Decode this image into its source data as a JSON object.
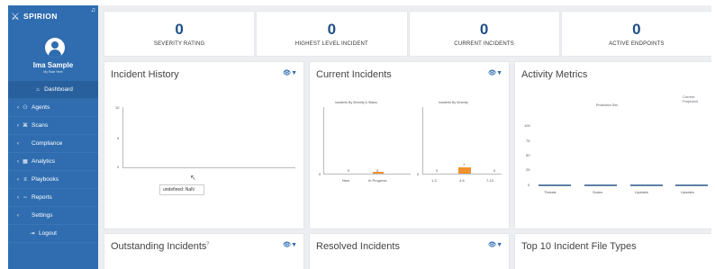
{
  "sidebar": {
    "brand": "SPIRION",
    "user_name": "Ima Sample",
    "user_role": "My Role Here",
    "items": [
      {
        "label": "Dashboard",
        "icon": "home-icon",
        "glyph": "⌂"
      },
      {
        "label": "Agents",
        "icon": "agents-icon",
        "glyph": "⚇"
      },
      {
        "label": "Scans",
        "icon": "scans-icon",
        "glyph": "⌘"
      },
      {
        "label": "Compliance",
        "icon": "compliance-icon",
        "glyph": ""
      },
      {
        "label": "Analytics",
        "icon": "analytics-icon",
        "glyph": "▦"
      },
      {
        "label": "Playbooks",
        "icon": "playbooks-icon",
        "glyph": "≡"
      },
      {
        "label": "Reports",
        "icon": "reports-icon",
        "glyph": "∼"
      },
      {
        "label": "Settings",
        "icon": "settings-icon",
        "glyph": ""
      },
      {
        "label": "Logout",
        "icon": "logout-icon",
        "glyph": "⇥"
      }
    ]
  },
  "stats": [
    {
      "value": "0",
      "label": "SEVERITY RATING"
    },
    {
      "value": "0",
      "label": "HIGHEST LEVEL INCIDENT"
    },
    {
      "value": "0",
      "label": "CURRENT INCIDENTS"
    },
    {
      "value": "0",
      "label": "ACTIVE ENDPOINTS"
    }
  ],
  "cards": {
    "incident_history": {
      "title": "Incident History",
      "tooltip": "undefined: NaN",
      "y_ticks": [
        "10",
        "5",
        "0"
      ]
    },
    "current_incidents": {
      "title": "Current Incidents",
      "left_title": "Incidents By Severity & Status",
      "right_title": "Incidents By Severity",
      "left_x": [
        "New",
        "In Progress"
      ],
      "left_values": [
        "0",
        "0"
      ],
      "right_x": [
        "1-3",
        "4-6",
        "7-10"
      ],
      "right_values": [
        "0",
        "1",
        "0"
      ]
    },
    "activity_metrics": {
      "title": "Activity Metrics",
      "chart_title": "Production Sim",
      "legend": [
        "Current",
        "Projected"
      ],
      "y_ticks": [
        "100",
        "75",
        "50",
        "25",
        "0"
      ],
      "x": [
        "Threats",
        "Scans",
        "Updates",
        "Updates"
      ]
    },
    "outstanding": {
      "title": "Outstanding Incidents"
    },
    "resolved": {
      "title": "Resolved Incidents"
    },
    "top_file_types": {
      "title": "Top 10 Incident File Types"
    }
  },
  "colors": {
    "sidebar": "#2f6db0",
    "stat_value": "#1f4f86",
    "accent_bar": "#f0922e"
  }
}
